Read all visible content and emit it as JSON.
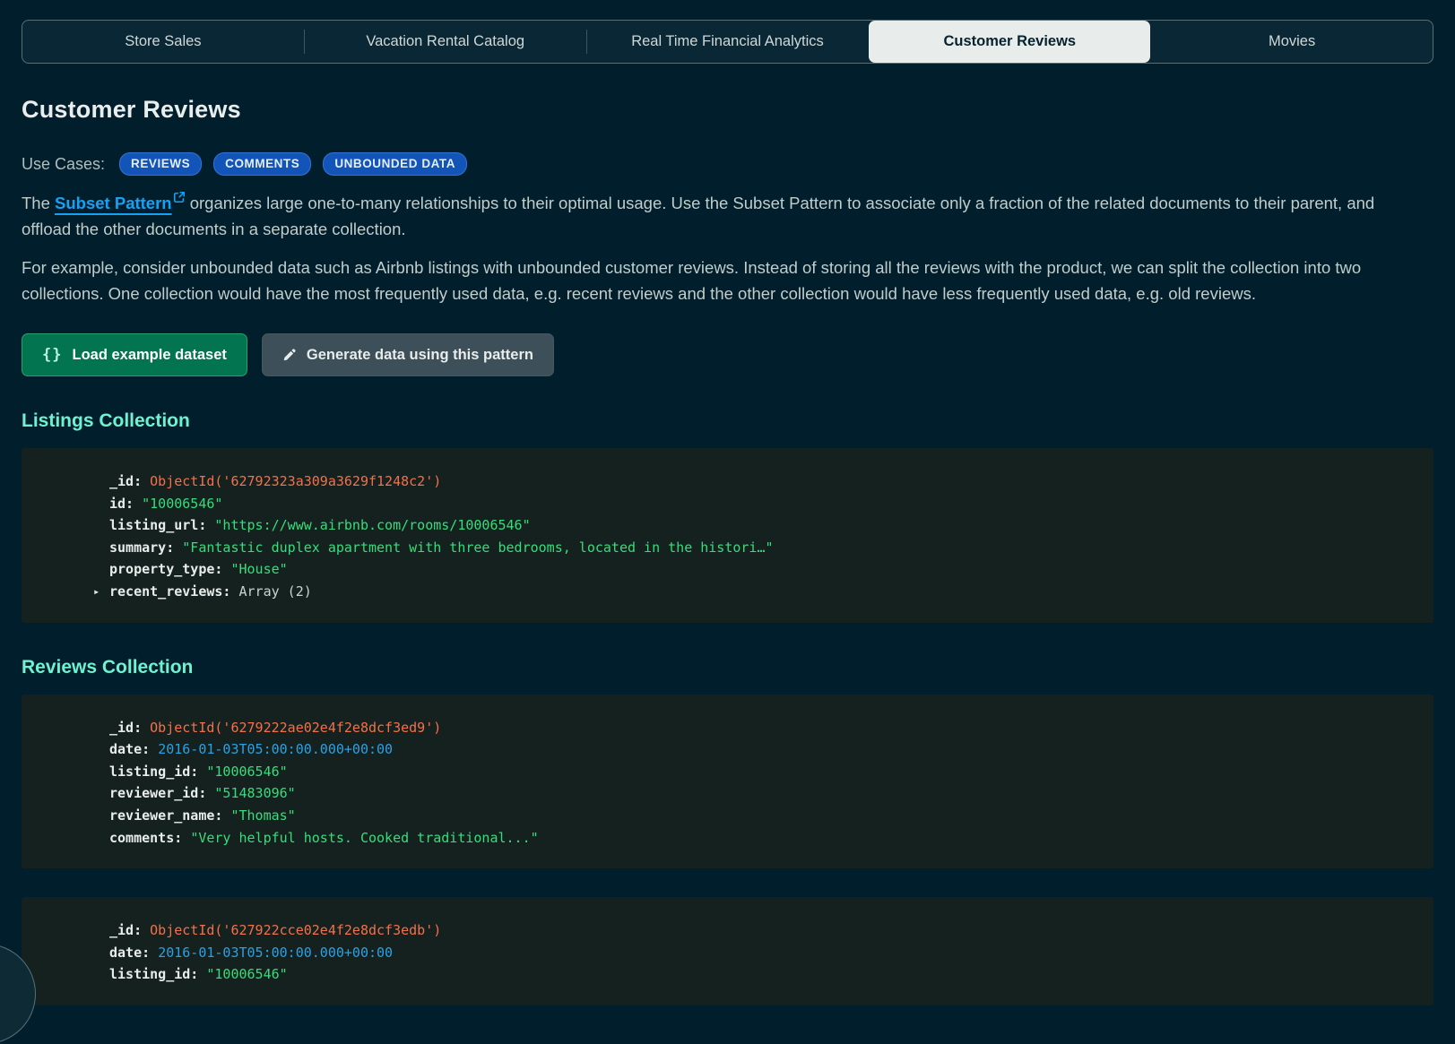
{
  "colors": {
    "page_bg": "#001E2B",
    "card_bg": "#15211E",
    "badge_blue": "#1254B7",
    "link_blue": "#14A2F6",
    "heading_teal": "#6FF2D1",
    "button_green": "#02744F",
    "button_gray": "#3D4F58",
    "code_key": "#E8EDEB",
    "code_string_green": "#35DE7B",
    "code_date_blue": "#2BA1E5",
    "code_objectid_orange": "#F4704B"
  },
  "tabs": [
    {
      "label": "Store Sales",
      "active": false
    },
    {
      "label": "Vacation Rental Catalog",
      "active": false
    },
    {
      "label": "Real Time Financial Analytics",
      "active": false
    },
    {
      "label": "Customer Reviews",
      "active": true
    },
    {
      "label": "Movies",
      "active": false
    }
  ],
  "page_title": "Customer Reviews",
  "use_cases": {
    "label": "Use Cases:",
    "badges": [
      "REVIEWS",
      "COMMENTS",
      "UNBOUNDED DATA"
    ]
  },
  "intro": {
    "before_link": "The ",
    "link_text": "Subset Pattern",
    "link_icon": "external-link-icon",
    "after_link": "  organizes large one-to-many relationships to their optimal usage. Use the Subset Pattern to associate only a fraction of the related documents to their parent, and offload the other documents in a separate collection."
  },
  "example_paragraph": "For example, consider unbounded data such as Airbnb listings with unbounded customer reviews. Instead of storing all the reviews with the product, we can split the collection into two collections. One collection would have the most frequently used data, e.g. recent reviews and the other collection would have less frequently used data, e.g. old reviews.",
  "buttons": [
    {
      "label": "Load example dataset",
      "icon": "braces-icon",
      "style": "green"
    },
    {
      "label": "Generate data using this pattern",
      "icon": "pencil-icon",
      "style": "gray"
    }
  ],
  "collections": [
    {
      "title": "Listings Collection",
      "documents": [
        {
          "fields": [
            {
              "key": "_id",
              "value": "ObjectId('62792323a309a3629f1248c2')",
              "type": "objectid"
            },
            {
              "key": "id",
              "value": "\"10006546\"",
              "type": "string"
            },
            {
              "key": "listing_url",
              "value": "\"https://www.airbnb.com/rooms/10006546\"",
              "type": "string"
            },
            {
              "key": "summary",
              "value": "\"Fantastic duplex apartment with three bedrooms, located in the histori…\"",
              "type": "string"
            },
            {
              "key": "property_type",
              "value": "\"House\"",
              "type": "string"
            },
            {
              "key": "recent_reviews",
              "value": "Array (2)",
              "type": "array",
              "expandable": true
            }
          ]
        }
      ]
    },
    {
      "title": "Reviews Collection",
      "documents": [
        {
          "fields": [
            {
              "key": "_id",
              "value": "ObjectId('6279222ae02e4f2e8dcf3ed9')",
              "type": "objectid"
            },
            {
              "key": "date",
              "value": "2016-01-03T05:00:00.000+00:00",
              "type": "date"
            },
            {
              "key": "listing_id",
              "value": "\"10006546\"",
              "type": "string"
            },
            {
              "key": "reviewer_id",
              "value": "\"51483096\"",
              "type": "string"
            },
            {
              "key": "reviewer_name",
              "value": "\"Thomas\"",
              "type": "string"
            },
            {
              "key": "comments",
              "value": "\"Very helpful hosts. Cooked traditional...\"",
              "type": "string"
            }
          ]
        },
        {
          "fields": [
            {
              "key": "_id",
              "value": "ObjectId('627922cce02e4f2e8dcf3edb')",
              "type": "objectid"
            },
            {
              "key": "date",
              "value": "2016-01-03T05:00:00.000+00:00",
              "type": "date"
            },
            {
              "key": "listing_id",
              "value": "\"10006546\"",
              "type": "string"
            }
          ]
        }
      ]
    }
  ],
  "icons": {
    "caret": "▸",
    "braces": "{}"
  }
}
